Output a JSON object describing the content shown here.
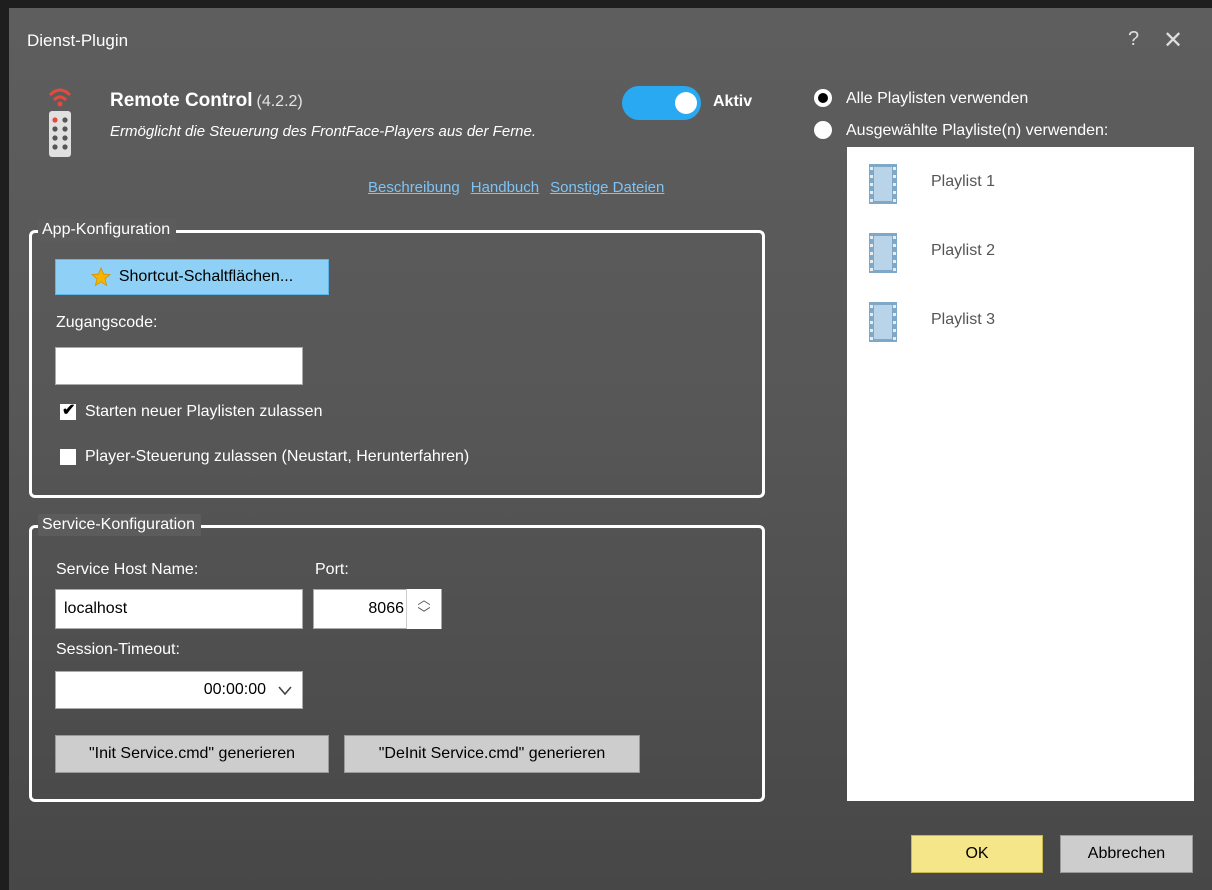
{
  "window": {
    "title": "Dienst-Plugin",
    "help_label": "?",
    "close_label": "✕"
  },
  "plugin": {
    "name": "Remote Control",
    "version": "(4.2.2)",
    "description": "Ermöglicht die Steuerung des FrontFace-Players aus der Ferne.",
    "icon": "remote-control-icon",
    "active_toggle": {
      "on": true,
      "label": "Aktiv"
    },
    "links": [
      "Beschreibung",
      "Handbuch",
      "Sonstige Dateien"
    ]
  },
  "app_config": {
    "legend": "App-Konfiguration",
    "shortcut_button": "Shortcut-Schaltflächen...",
    "access_code_label": "Zugangscode:",
    "access_code_value": "",
    "checkboxes": [
      {
        "label": "Starten neuer Playlisten zulassen",
        "checked": true
      },
      {
        "label": "Player-Steuerung zulassen (Neustart, Herunterfahren)",
        "checked": false
      }
    ]
  },
  "service_config": {
    "legend": "Service-Konfiguration",
    "host_label": "Service Host Name:",
    "host_value": "localhost",
    "port_label": "Port:",
    "port_value": "8066",
    "timeout_label": "Session-Timeout:",
    "timeout_value": "00:00:00",
    "init_button": "\"Init Service.cmd\" generieren",
    "deinit_button": "\"DeInit Service.cmd\" generieren"
  },
  "playlists": {
    "options": [
      {
        "label": "Alle Playlisten verwenden",
        "selected": true
      },
      {
        "label": "Ausgewählte Playliste(n) verwenden:",
        "selected": false
      }
    ],
    "items": [
      "Playlist 1",
      "Playlist 2",
      "Playlist 3"
    ]
  },
  "footer": {
    "ok_label": "OK",
    "cancel_label": "Abbrechen"
  },
  "colors": {
    "accent": "#29a9f1",
    "link": "#7ec3f3",
    "ok_button": "#f5e68a"
  }
}
